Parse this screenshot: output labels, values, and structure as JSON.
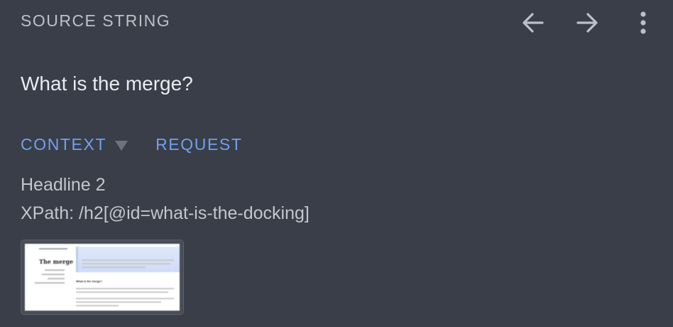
{
  "header": {
    "title": "SOURCE STRING",
    "back_icon": "arrow-left-icon",
    "forward_icon": "arrow-right-icon",
    "more_icon": "more-vertical-icon"
  },
  "source": {
    "text": "What is the merge?"
  },
  "tabs": [
    {
      "label": "CONTEXT"
    },
    {
      "label": "REQUEST"
    }
  ],
  "context": {
    "headline": "Headline 2",
    "xpath": "XPath: /h2[@id=what-is-the-docking]"
  },
  "thumbnail": {
    "page_title": "The merge",
    "section_title": "What is the merge?"
  },
  "colors": {
    "background": "#393e48",
    "accent": "#6fa2ee",
    "text_primary": "#e9ebef",
    "text_secondary": "#c3c6cc",
    "icon": "#bcc0c8"
  }
}
